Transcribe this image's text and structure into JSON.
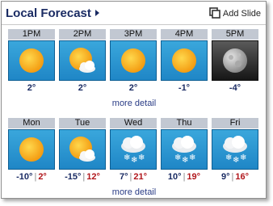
{
  "header": {
    "title": "Local Forecast",
    "add_slide": "Add Slide"
  },
  "hourly": {
    "items": [
      {
        "label": "1PM",
        "icon": "sun-icon",
        "temp": "2°"
      },
      {
        "label": "2PM",
        "icon": "partly-cloudy-icon",
        "temp": "2°"
      },
      {
        "label": "3PM",
        "icon": "sun-icon",
        "temp": "2°"
      },
      {
        "label": "4PM",
        "icon": "sun-icon",
        "temp": "-1°"
      },
      {
        "label": "5PM",
        "icon": "moon-icon",
        "temp": "-4°"
      }
    ],
    "more_detail": "more detail"
  },
  "daily": {
    "items": [
      {
        "label": "Mon",
        "icon": "sun-icon",
        "low": "-10°",
        "high": "2°"
      },
      {
        "label": "Tue",
        "icon": "partly-cloudy-icon",
        "low": "-15°",
        "high": "12°"
      },
      {
        "label": "Wed",
        "icon": "snow-icon",
        "low": "7°",
        "high": "21°"
      },
      {
        "label": "Thu",
        "icon": "snow-icon",
        "low": "10°",
        "high": "19°"
      },
      {
        "label": "Fri",
        "icon": "snow-icon",
        "low": "9°",
        "high": "16°"
      }
    ],
    "more_detail": "more detail"
  },
  "colors": {
    "title": "#1a2b63",
    "tile_sky": "#1f86c6",
    "label_bar": "#c2c8d2",
    "high_temp": "#b1161b"
  }
}
